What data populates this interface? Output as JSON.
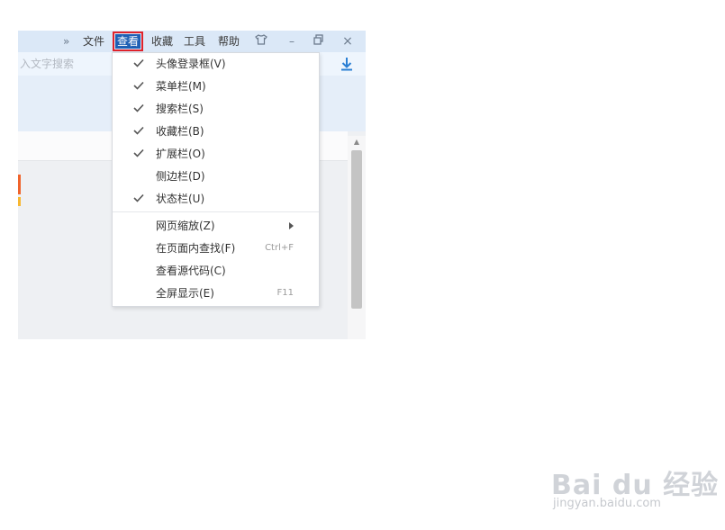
{
  "menubar": {
    "overflow": "»",
    "items": [
      "文件",
      "查看",
      "收藏",
      "工具",
      "帮助"
    ],
    "active_index": 1
  },
  "window_controls": {
    "skin": "skin-icon",
    "minimize": "–",
    "restore": "▫",
    "close": "×"
  },
  "address_bar": {
    "search_placeholder": "入文字搜索"
  },
  "view_menu": {
    "items": [
      {
        "label": "头像登录框(V)",
        "checked": true,
        "shortcut": ""
      },
      {
        "label": "菜单栏(M)",
        "checked": true,
        "shortcut": ""
      },
      {
        "label": "搜索栏(S)",
        "checked": true,
        "shortcut": ""
      },
      {
        "label": "收藏栏(B)",
        "checked": true,
        "shortcut": ""
      },
      {
        "label": "扩展栏(O)",
        "checked": true,
        "shortcut": ""
      },
      {
        "label": "侧边栏(D)",
        "checked": false,
        "shortcut": ""
      },
      {
        "label": "状态栏(U)",
        "checked": true,
        "shortcut": ""
      },
      {
        "label": "网页缩放(Z)",
        "checked": false,
        "shortcut": "",
        "submenu": true
      },
      {
        "label": "在页面内查找(F)",
        "checked": false,
        "shortcut": "Ctrl+F"
      },
      {
        "label": "查看源代码(C)",
        "checked": false,
        "shortcut": ""
      },
      {
        "label": "全屏显示(E)",
        "checked": false,
        "shortcut": "F11"
      }
    ]
  },
  "watermark": {
    "brand": "Bai du 经验",
    "url": "jingyan.baidu.com"
  },
  "colors": {
    "accent": "#1e5fb4",
    "highlight_box": "#e0232b",
    "download_icon": "#2a7fd4"
  }
}
